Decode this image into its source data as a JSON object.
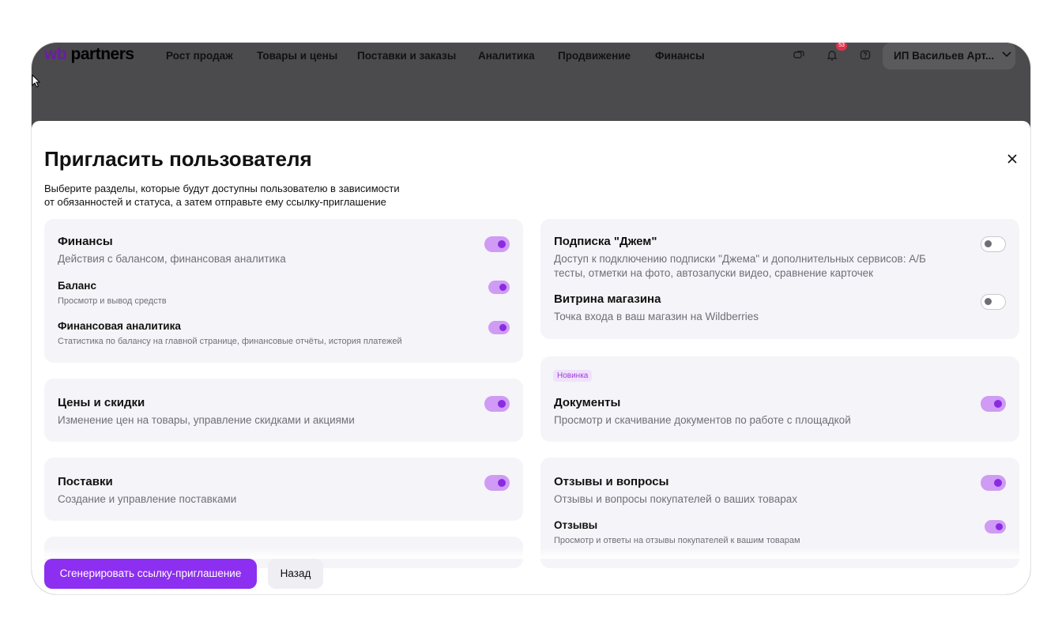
{
  "nav": {
    "logo_wb": "wb",
    "logo_partners": "partners",
    "items": [
      "Рост продаж",
      "Товары и цены",
      "Поставки и заказы",
      "Аналитика",
      "Продвижение",
      "Финансы"
    ],
    "badge": "53",
    "user_name": "ИП Васильев Арт..."
  },
  "modal": {
    "title": "Пригласить пользователя",
    "subtitle_line1": "Выберите разделы, которые будут доступны пользователю в зависимости",
    "subtitle_line2": "от обязанностей и статуса, а затем отправьте ему ссылку-приглашение"
  },
  "left": {
    "finance": {
      "title": "Финансы",
      "desc": "Действия с балансом, финансовая аналитика",
      "enabled": true,
      "subs": [
        {
          "title": "Баланс",
          "desc": "Просмотр и вывод средств",
          "enabled": true
        },
        {
          "title": "Финансовая аналитика",
          "desc": "Статистика по балансу на главной странице, финансовые отчёты, история платежей",
          "enabled": true
        }
      ]
    },
    "prices": {
      "title": "Цены и скидки",
      "desc": "Изменение цен на товары, управление скидками и акциями",
      "enabled": true
    },
    "supplies": {
      "title": "Поставки",
      "desc": "Создание и управление поставками",
      "enabled": true
    }
  },
  "right": {
    "jam": {
      "title": "Подписка \"Джем\"",
      "desc_line1": "Доступ к подключению подписки \"Джема\" и дополнительных сервисов: А/Б",
      "desc_line2": "тесты, отметки на фото, автозапуски видео, сравнение карточек",
      "enabled": false
    },
    "storefront": {
      "title": "Витрина магазина",
      "desc": "Точка входа в ваш магазин на Wildberries",
      "enabled": false
    },
    "documents": {
      "tag": "Новинка",
      "title": "Документы",
      "desc": "Просмотр и скачивание документов по работе с площадкой",
      "enabled": true
    },
    "reviews": {
      "title": "Отзывы и вопросы",
      "desc": "Отзывы и вопросы покупателей о ваших товарах",
      "enabled": true,
      "subs": [
        {
          "title": "Отзывы",
          "desc": "Просмотр и ответы на отзывы покупателей к вашим товарам",
          "enabled": true
        }
      ]
    }
  },
  "buttons": {
    "generate": "Сгенерировать ссылку-приглашение",
    "back": "Назад"
  },
  "icons": {
    "chat": "chat-icon",
    "bell": "bell-icon",
    "help": "help-icon",
    "chevron": "chevron-down-icon",
    "close": "close-icon",
    "cursor": "cursor-icon"
  },
  "colors": {
    "accent": "#8d2ff0",
    "toggle_on_track": "#cf9bf5",
    "toggle_on_knob": "#8a2be2",
    "card_bg": "#f5f4f8",
    "overlay": "#4b4b4d"
  }
}
